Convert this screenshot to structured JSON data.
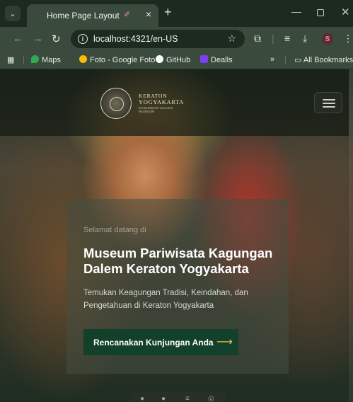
{
  "browser": {
    "tab_title": "Home Page Layout",
    "tab_emoji": "✐",
    "new_tab_symbol": "+",
    "url": "localhost:4321/en-US",
    "profile_initial": "S",
    "bookmarks": [
      {
        "label": "Maps",
        "color": "#34a853"
      },
      {
        "label": "Foto - Google Foto",
        "color": "#fbbc04"
      },
      {
        "label": "GitHub",
        "color": "#ffffff"
      },
      {
        "label": "Dealls",
        "color": "#7b3ff2"
      }
    ],
    "more_bookmarks": "»",
    "all_bookmarks": "All Bookmarks"
  },
  "site": {
    "logo_line1": "KERATON",
    "logo_line2": "YOGYAKARTA",
    "logo_line3": "KAGUNGAN DALEM",
    "logo_line4": "MUSEUM",
    "menu_icon": "hamburger-icon"
  },
  "hero": {
    "welcome": "Selamat datang di",
    "title": "Museum Pariwisata Kagungan Dalem Keraton Yogyakarta",
    "subtitle": "Temukan Keagungan Tradisi, Keindahan, dan Pengetahuan di Keraton Yogyakarta",
    "cta_label": "Rencanakan Kunjungan Anda",
    "cta_arrow": "⟶"
  },
  "colors": {
    "accent_gold": "#e4c24a",
    "cta_green": "#13402a"
  }
}
